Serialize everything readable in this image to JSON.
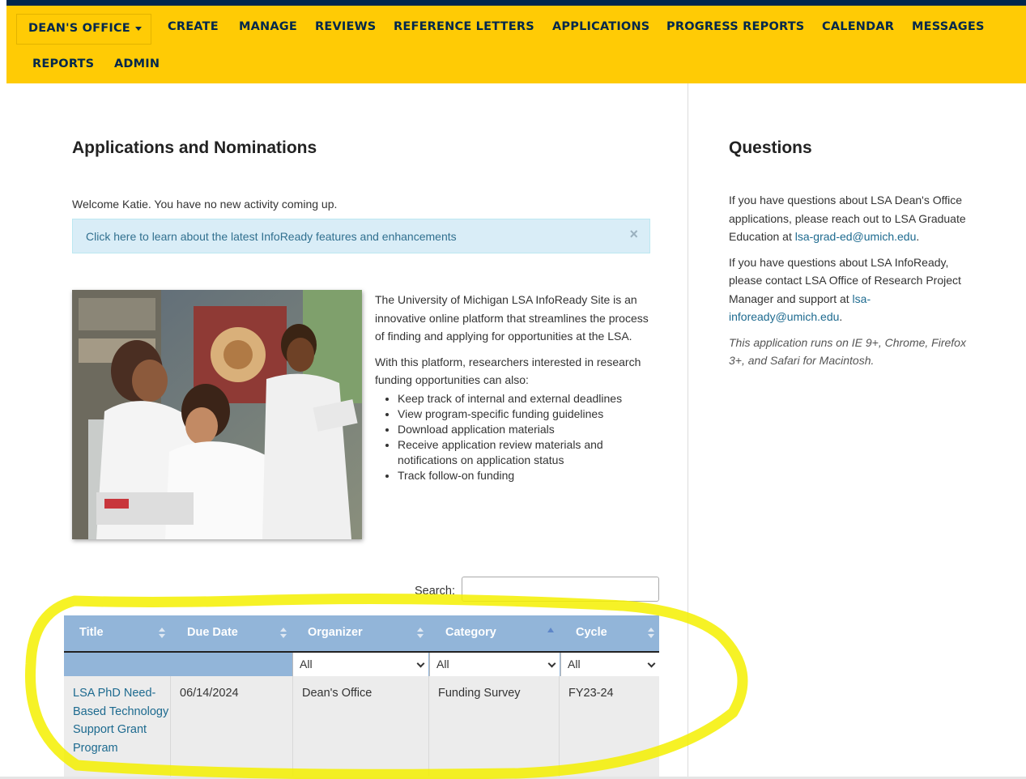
{
  "nav": {
    "items": [
      "DEAN'S OFFICE",
      "CREATE",
      "MANAGE",
      "REVIEWS",
      "REFERENCE LETTERS",
      "APPLICATIONS",
      "PROGRESS REPORTS",
      "CALENDAR",
      "MESSAGES",
      "REPORTS",
      "ADMIN"
    ]
  },
  "main": {
    "title": "Applications and Nominations",
    "welcome": "Welcome Katie. You have no new activity coming up.",
    "alert_text": "Click here to learn about the latest InfoReady features and enhancements",
    "alert_close": "×",
    "intro_p1": "The University of Michigan LSA InfoReady Site is an innovative online platform that streamlines the process of finding and applying for opportunities at the LSA.",
    "intro_p2": "With this platform, researchers interested in research funding opportunities can also:",
    "bullets": [
      "Keep track of internal and external deadlines",
      "View program-specific funding guidelines",
      "Download application materials",
      "Receive application review materials and notifications on application status",
      "Track follow-on funding"
    ]
  },
  "sidebar": {
    "title": "Questions",
    "p1_text": "If you have questions about LSA Dean's Office applications, please reach out to LSA Graduate Education at ",
    "p1_email": "lsa-grad-ed@umich.edu",
    "p1_end": ".",
    "p2_text": "If you have questions about LSA InfoReady, please contact LSA Office of Research Project Manager and support at ",
    "p2_email": "lsa-infoready@umich.edu",
    "p2_end": ".",
    "note": "This application runs on IE 9+, Chrome, Firefox 3+, and Safari for Macintosh."
  },
  "table": {
    "search_label": "Search:",
    "search_value": "",
    "headers": [
      "Title",
      "Due Date",
      "Organizer",
      "Category",
      "Cycle"
    ],
    "filters": [
      "All",
      "All",
      "All"
    ],
    "rows": [
      {
        "title": "LSA PhD Need-Based Technology Support Grant Program",
        "due": "06/14/2024",
        "organizer": "Dean's Office",
        "category": "Funding Survey",
        "cycle": "FY23-24"
      }
    ]
  },
  "colors": {
    "nav_bg": "#ffcb05",
    "nav_text": "#00274c",
    "table_header": "#92b5d9",
    "link": "#1d6a8f",
    "highlight": "#f5f000"
  }
}
